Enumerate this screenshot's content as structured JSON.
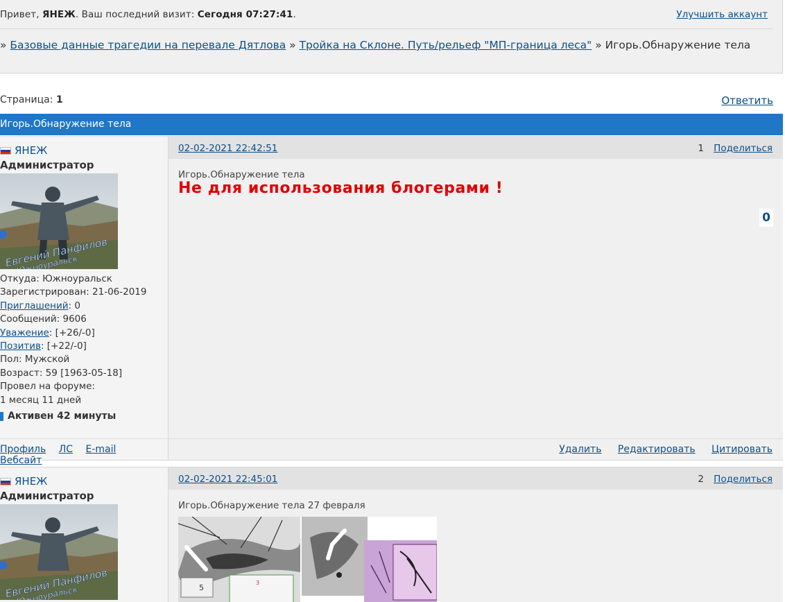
{
  "header": {
    "greeting_prefix": "Привет,",
    "username": "ЯНЕЖ",
    "last_visit_label": ". Ваш последний визит:",
    "last_visit_value": "Сегодня 07:27:41",
    "last_visit_suffix": ".",
    "upgrade_link": "Улучшить аккаунт"
  },
  "breadcrumb": {
    "sep": "»",
    "items": [
      "Базовые данные трагедии на перевале Дятлова",
      "Тройка на Склоне. Путь/рельеф \"МП-граница леса\""
    ],
    "current": "Игорь.Обнаружение тела"
  },
  "pagination": {
    "label": "Страница:",
    "current": "1",
    "reply": "Ответить"
  },
  "topic_title": "Игорь.Обнаружение тела",
  "posts": [
    {
      "author": "ЯНЕЖ",
      "role": "Администратор",
      "avatar_caption_1": "Евгений Панфилов",
      "avatar_caption_2": "Южноуральск",
      "info": [
        "Откуда: Южноуральск",
        "Зарегистрирован: 21-06-2019",
        [
          "Приглашений",
          ": 0"
        ],
        "Сообщений: 9606",
        [
          "Уважение",
          ": [+26/-0]"
        ],
        [
          "Позитив",
          ": [+22/-0]"
        ],
        "Пол: Мужской",
        "Возраст: 59 [1963-05-18]",
        "Провел на форуме:",
        "1 месяц 11 дней"
      ],
      "active": "Активен 42 минуты",
      "date": "02-02-2021 22:42:51",
      "number": "1",
      "share": "Поделиться",
      "title": "Игорь.Обнаружение тела",
      "warning": "Не для использования блогерами !",
      "rating": "0",
      "profile_links": [
        "Профиль",
        "ЛС",
        "E-mail",
        "Вебсайт"
      ],
      "actions": [
        "Удалить",
        "Редактировать",
        "Цитировать"
      ]
    },
    {
      "author": "ЯНЕЖ",
      "role": "Администратор",
      "avatar_caption_1": "Евгений Панфилов",
      "avatar_caption_2": "Южноуральск",
      "date": "02-02-2021 22:45:01",
      "number": "2",
      "share": "Поделиться",
      "title": "Игорь.Обнаружение тела 27 февраля",
      "image_labels": [
        "5",
        "3"
      ]
    }
  ],
  "colors": {
    "topic_bar": "#1f77c8",
    "link": "#0b4f8a",
    "warning": "#e00000"
  }
}
